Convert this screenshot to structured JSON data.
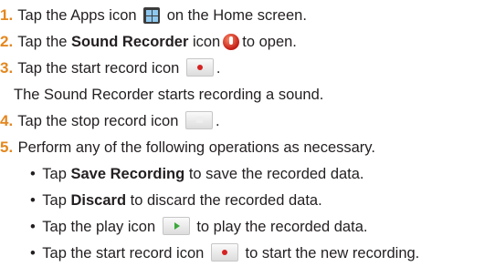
{
  "steps": [
    {
      "num": "1.",
      "before": "Tap the Apps icon",
      "after": "on the Home screen.",
      "icon": "apps-grid-icon"
    },
    {
      "num": "2.",
      "before": "Tap the",
      "bold": "Sound Recorder",
      "middle": "icon",
      "after": "to open.",
      "icon": "sound-recorder-icon"
    },
    {
      "num": "3.",
      "before": "Tap the start record icon",
      "after": ".",
      "icon": "record-icon"
    },
    {
      "note": "The Sound Recorder starts recording a sound."
    },
    {
      "num": "4.",
      "before": "Tap the stop record icon",
      "after": ".",
      "icon": "stop-icon"
    },
    {
      "num": "5.",
      "text": "Perform any of the following operations as necessary."
    }
  ],
  "bullets": [
    {
      "marker": "•",
      "before": "Tap",
      "bold": "Save Recording",
      "after": "to save the recorded data."
    },
    {
      "marker": "•",
      "before": "Tap",
      "bold": "Discard",
      "after": "to discard the recorded data."
    },
    {
      "marker": "•",
      "before": "Tap the play icon",
      "after": "to play the recorded data.",
      "icon": "play-icon"
    },
    {
      "marker": "•",
      "before": "Tap the start record icon",
      "after": "to start the new recording.",
      "icon": "record-icon"
    }
  ],
  "colors": {
    "step_number": "#e4871f",
    "text": "#231f20"
  }
}
